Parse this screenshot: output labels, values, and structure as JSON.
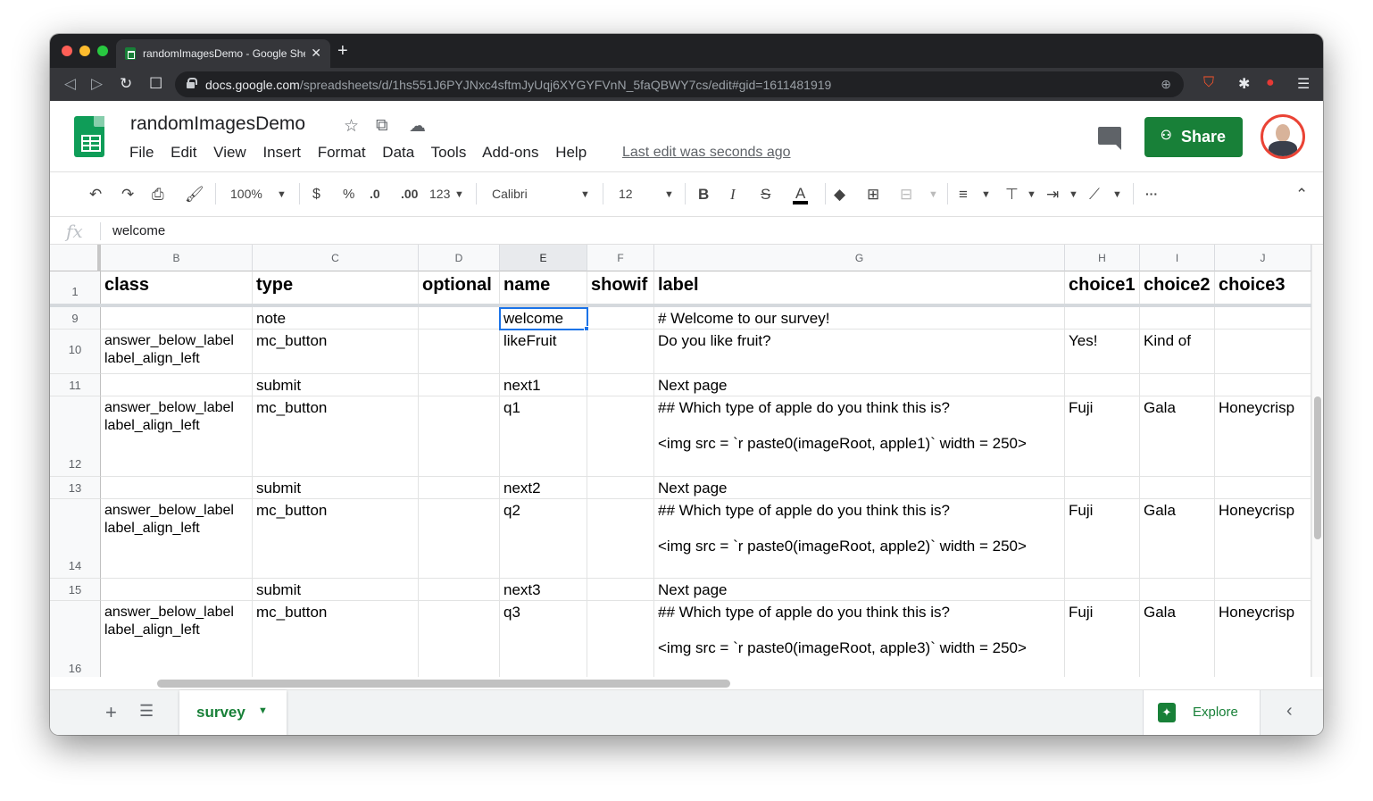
{
  "browser": {
    "tab_title": "randomImagesDemo - Google Sheets",
    "url_host": "docs.google.com",
    "url_path": "/spreadsheets/d/1hs551J6PYJNxc4sftmJyUqj6XYGYFVnN_5faQBWY7cs/edit#gid=1611481919"
  },
  "doc": {
    "title": "randomImagesDemo",
    "menus": [
      "File",
      "Edit",
      "View",
      "Insert",
      "Format",
      "Data",
      "Tools",
      "Add-ons",
      "Help"
    ],
    "last_edit": "Last edit was seconds ago",
    "share_label": "Share"
  },
  "toolbar": {
    "zoom": "100%",
    "currency": "$",
    "percent": "%",
    "dec_less": ".0",
    "dec_more": ".00",
    "format_more": "123",
    "font": "Calibri",
    "font_size": "12",
    "bold": "B",
    "italic": "I",
    "strike": "S",
    "text_color": "A",
    "more": "···"
  },
  "formula_bar": {
    "fx": "fx",
    "value": "welcome"
  },
  "columns": [
    "B",
    "C",
    "D",
    "E",
    "F",
    "G",
    "H",
    "I",
    "J"
  ],
  "selected_column": "E",
  "rows": [
    {
      "num": "1",
      "cells": [
        "class",
        "type",
        "optional",
        "name",
        "showif",
        "label",
        "choice1",
        "choice2",
        "choice3"
      ]
    },
    {
      "num": "9",
      "cells": [
        "",
        "note",
        "",
        "welcome",
        "",
        "# Welcome to our survey!",
        "",
        "",
        ""
      ]
    },
    {
      "num": "10",
      "cells": [
        "answer_below_label\nlabel_align_left",
        "mc_button",
        "",
        "likeFruit",
        "",
        "Do you like fruit?",
        "Yes!",
        "Kind of",
        ""
      ]
    },
    {
      "num": "11",
      "cells": [
        "",
        "submit",
        "",
        "next1",
        "",
        "Next page",
        "",
        "",
        ""
      ]
    },
    {
      "num": "12",
      "cells": [
        "answer_below_label\nlabel_align_left",
        "mc_button",
        "",
        "q1",
        "",
        "## Which type of apple do you think this is?\n\n<img src = `r paste0(imageRoot, apple1)` width = 250>",
        "Fuji",
        "Gala",
        "Honeycrisp"
      ]
    },
    {
      "num": "13",
      "cells": [
        "",
        "submit",
        "",
        "next2",
        "",
        "Next page",
        "",
        "",
        ""
      ]
    },
    {
      "num": "14",
      "cells": [
        "answer_below_label\nlabel_align_left",
        "mc_button",
        "",
        "q2",
        "",
        "## Which type of apple do you think this is?\n\n<img src = `r paste0(imageRoot, apple2)` width = 250>",
        "Fuji",
        "Gala",
        "Honeycrisp"
      ]
    },
    {
      "num": "15",
      "cells": [
        "",
        "submit",
        "",
        "next3",
        "",
        "Next page",
        "",
        "",
        ""
      ]
    },
    {
      "num": "16",
      "cells": [
        "answer_below_label\nlabel_align_left",
        "mc_button",
        "",
        "q3",
        "",
        "## Which type of apple do you think this is?\n\n<img src = `r paste0(imageRoot, apple3)` width = 250>",
        "Fuji",
        "Gala",
        "Honeycrisp"
      ]
    }
  ],
  "sheet": {
    "tab_name": "survey",
    "explore_label": "Explore"
  },
  "colors": {
    "accent": "#188038",
    "selection": "#1a73e8"
  }
}
